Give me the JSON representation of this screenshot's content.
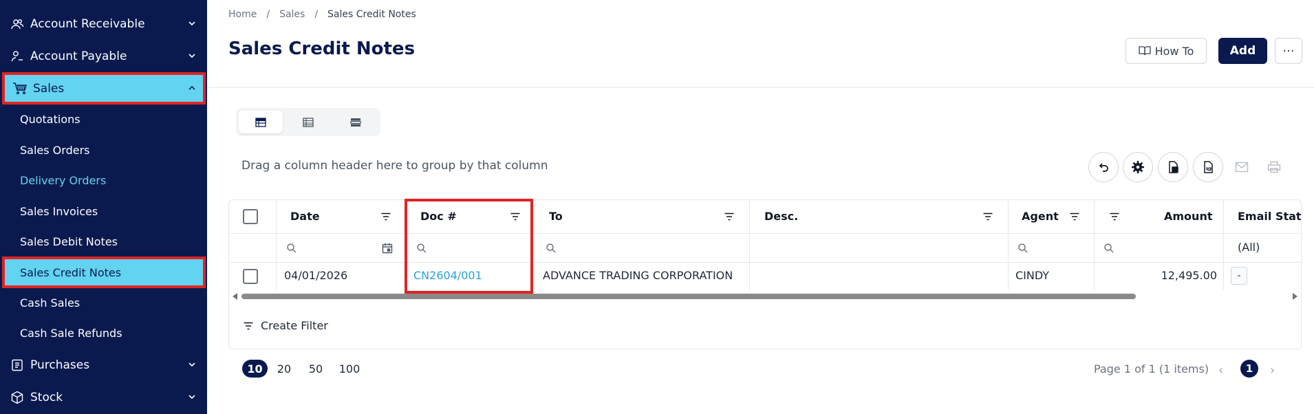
{
  "sidebar": {
    "account_receivable": "Account Receivable",
    "account_payable": "Account Payable",
    "sales": "Sales",
    "sub_items": [
      "Quotations",
      "Sales Orders",
      "Delivery Orders",
      "Sales Invoices",
      "Sales Debit Notes",
      "Sales Credit Notes",
      "Cash Sales",
      "Cash Sale Refunds"
    ],
    "purchases": "Purchases",
    "stock": "Stock"
  },
  "breadcrumb": [
    "Home",
    "Sales",
    "Sales Credit Notes"
  ],
  "breadcrumb_sep": "/",
  "page_title": "Sales Credit Notes",
  "header": {
    "howto_label": "How To",
    "add_label": "Add",
    "more_label": "···"
  },
  "group_hint": "Drag a column header here to group by that column",
  "columns": {
    "date": "Date",
    "doc": "Doc #",
    "to": "To",
    "desc": "Desc.",
    "agent": "Agent",
    "amount": "Amount",
    "email_status": "Email Statu"
  },
  "filter_all": "(All)",
  "rows": [
    {
      "date": "04/01/2026",
      "doc": "CN2604/001",
      "to": "ADVANCE TRADING CORPORATION",
      "desc": "",
      "agent": "CINDY",
      "amount": "12,495.00",
      "email_status": "-"
    }
  ],
  "create_filter": "Create Filter",
  "page_sizes": [
    "10",
    "20",
    "50",
    "100"
  ],
  "pager_info": "Page 1 of 1 (1 items)",
  "current_page": "1",
  "pager_prev": "‹",
  "pager_next": "›",
  "colors": {
    "sidebar_bg": "#0a1a4f",
    "active_bg": "#62d3f0",
    "highlight_border": "#e02424",
    "link": "#2b9fd8"
  }
}
